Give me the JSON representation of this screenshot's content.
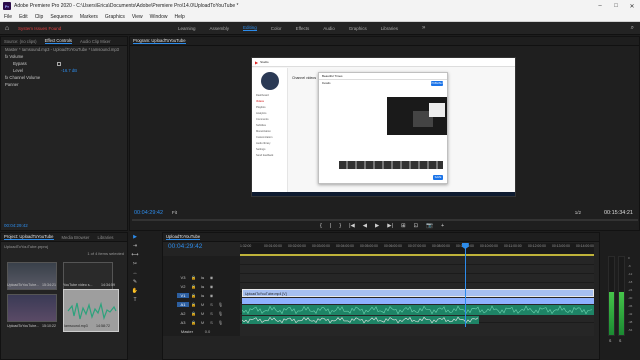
{
  "window": {
    "title": "Adobe Premiere Pro 2020 - C:\\Users\\Erica\\Documents\\Adobe\\Premiere Pro\\14.0\\UploadToYouTube *",
    "logo": "Pr"
  },
  "menu": [
    "File",
    "Edit",
    "Clip",
    "Sequence",
    "Markers",
    "Graphics",
    "View",
    "Window",
    "Help"
  ],
  "workspaces": {
    "alert": "System Issues Found",
    "items": [
      "Learning",
      "Assembly",
      "Editing",
      "Color",
      "Effects",
      "Audio",
      "Graphics",
      "Libraries"
    ],
    "active": "Editing",
    "more": "»"
  },
  "effect_controls": {
    "tabs": [
      "Source: (no clips)",
      "Effect Controls",
      "Audio Clip Mixer"
    ],
    "active_tab": "Effect Controls",
    "subtitle": "Master * Iamsound.mp3 - UploadToYouTube * Iamsound.mp3",
    "rows": [
      {
        "label": "fx  Volume",
        "value": ""
      },
      {
        "label": "Bypass",
        "value": ""
      },
      {
        "label": "Level",
        "value": "-16.7 dB"
      },
      {
        "label": "fx  Channel Volume",
        "value": ""
      },
      {
        "label": "Panner",
        "value": ""
      }
    ],
    "timecode": "00:04:29:42"
  },
  "program": {
    "tab": "Program: UploadToYouTube",
    "timecode_left": "00:04:29:42",
    "fit": "Fit",
    "quality": "1/2",
    "timecode_right": "00:15:34:21",
    "transport": [
      "{",
      "|",
      "}",
      "|◀",
      "◀",
      "▶",
      "▶|",
      "⊞",
      "⊡",
      "📷",
      "+"
    ]
  },
  "inner_screen": {
    "studio_title": "Studio",
    "channel_heading": "Channel videos",
    "dialog_title": "Beautiful Times",
    "dialog_tab": "Details",
    "upload_btn": "PUBLISH",
    "save_btn": "SAVE",
    "nav": [
      "Dashboard",
      "Videos",
      "Playlists",
      "Analytics",
      "Comments",
      "Subtitles",
      "Monetization",
      "Customization",
      "Audio library",
      "Settings",
      "Send feedback"
    ]
  },
  "project": {
    "tabs": [
      "Project: UploadToYouTube",
      "Media Browser",
      "Libraries"
    ],
    "active_tab": "Project: UploadToYouTube",
    "file": "UploadToYouTube.prproj",
    "selection": "1 of 4 items selected",
    "items": [
      {
        "name": "UploadToYouTube...",
        "duration": "15:34:21"
      },
      {
        "name": "YouTube video s...",
        "duration": "14:34:59"
      },
      {
        "name": "UploadToYouTube...",
        "duration": "15:10:22"
      },
      {
        "name": "Iamsound.mp3",
        "duration": "14:58:72"
      }
    ]
  },
  "timeline": {
    "tab": "UploadToYouTube",
    "timecode": "00:04:29:42",
    "ruler": [
      "1:32:00",
      "00:01:00:00",
      "00:02:00:00",
      "00:03:00:00",
      "00:04:00:00",
      "00:05:00:00",
      "00:06:00:00",
      "00:07:00:00",
      "00:08:00:00",
      "00:09:00:00",
      "00:10:00:00",
      "00:11:00:00",
      "00:12:00:00",
      "00:13:00:00",
      "00:14:00:00"
    ],
    "tracks": [
      {
        "label": "V3",
        "kind": "video"
      },
      {
        "label": "V2",
        "kind": "video"
      },
      {
        "label": "V1",
        "kind": "video"
      },
      {
        "label": "A1",
        "kind": "audio"
      },
      {
        "label": "A2",
        "kind": "audio"
      },
      {
        "label": "A3",
        "kind": "audio"
      }
    ],
    "master": {
      "label": "Master",
      "value": "0.0"
    },
    "clip_v1": "UploadToYouTube.mp4 [V]",
    "playhead_fraction": 0.635
  },
  "audio_meter": {
    "scale": [
      "0",
      "-6",
      "-12",
      "-18",
      "-24",
      "-30",
      "-36",
      "-42",
      "-48",
      "-54"
    ],
    "left_level": 0.55,
    "right_level": 0.55,
    "labels": [
      "S",
      "S"
    ]
  },
  "colors": {
    "accent": "#2d8ceb",
    "video_clip": "#8eb1ff",
    "audio_clip": "#1e8466",
    "alert": "#e04040"
  }
}
